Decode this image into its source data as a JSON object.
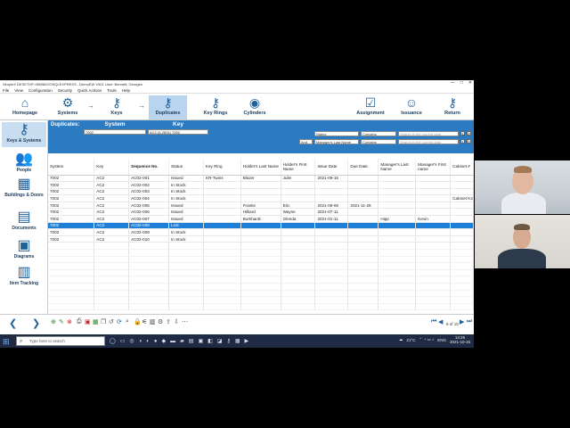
{
  "window": {
    "title": "SimpleX  DESKTOP-9KB56OO\\SQLEXPRESS - DemoEW V501     User: Bennett, Georges",
    "controls": [
      "—",
      "□",
      "✕"
    ]
  },
  "menu": [
    "File",
    "View",
    "Configuration",
    "Security",
    "Quick Actions",
    "Tools",
    "Help"
  ],
  "toolbar": {
    "items": [
      {
        "label": "Homepage",
        "icon": "building-icon"
      },
      {
        "label": "Systems",
        "icon": "systems-icon"
      },
      {
        "label": "Keys",
        "icon": "key-icon"
      },
      {
        "label": "Duplicates",
        "icon": "duplicate-keys-icon",
        "active": true
      },
      {
        "label": "Key Rings",
        "icon": "keyring-icon"
      },
      {
        "label": "Cylinders",
        "icon": "cylinder-icon"
      },
      {
        "label": "Assignment",
        "icon": "assignment-icon"
      },
      {
        "label": "Issuance",
        "icon": "issuance-icon"
      },
      {
        "label": "Return",
        "icon": "return-icon"
      }
    ]
  },
  "sidebar": [
    {
      "label": "Keys & Systems",
      "icon": "key-icon",
      "active": true
    },
    {
      "label": "People",
      "icon": "people-icon"
    },
    {
      "label": "Buildings & Doors",
      "icon": "building-icon"
    },
    {
      "label": "Documents",
      "icon": "documents-icon"
    },
    {
      "label": "Diagrams",
      "icon": "diagram-icon"
    },
    {
      "label": "Item Tracking",
      "icon": "item-tracking-icon"
    }
  ],
  "duplicates": {
    "title": "Duplicates:",
    "system_header": "System",
    "key_header": "Key",
    "system_value": "7002",
    "key_value": "AC2 (4-2831) 7002"
  },
  "filters": {
    "row1": {
      "field": "Status",
      "op": "Contains",
      "placeholder": "Search in the current data"
    },
    "row2": {
      "conj": "And",
      "field": "Manager's Last Name",
      "op": "Contains",
      "placeholder": "Search in the current data"
    }
  },
  "table": {
    "columns": [
      "System",
      "Key",
      "Sequence No.",
      "Status",
      "Key Ring",
      "Holder's Last Name",
      "Holder's First Name",
      "Issue Date",
      "Due Date",
      "Manager's Last Name",
      "Manager's First name",
      "Cabinet #"
    ],
    "rows": [
      [
        "7002",
        "AC2",
        "AC02-001",
        "Issued",
        "KR-Twins",
        "Blazer",
        "Julie",
        "2021-09-15",
        "",
        "",
        "",
        ""
      ],
      [
        "7002",
        "AC2",
        "AC02-002",
        "In Stock",
        "",
        "",
        "",
        "",
        "",
        "",
        "",
        ""
      ],
      [
        "7002",
        "AC2",
        "AC02-003",
        "In Stock",
        "",
        "",
        "",
        "",
        "",
        "",
        "",
        ""
      ],
      [
        "7002",
        "AC2",
        "AC02-004",
        "In Stock",
        "",
        "",
        "",
        "",
        "",
        "",
        "",
        "Cabinet K2"
      ],
      [
        "7002",
        "AC2",
        "AC02-005",
        "Issued",
        "",
        "Franke",
        "Eric",
        "2021-09-06",
        "2021-11-26",
        "",
        "",
        ""
      ],
      [
        "7002",
        "AC2",
        "AC02-006",
        "Issued",
        "",
        "Hilliard",
        "Wayne",
        "2021-07-11",
        "",
        "",
        "",
        ""
      ],
      [
        "7002",
        "AC2",
        "AC02-007",
        "Issued",
        "",
        "Burkhardt",
        "Glenda",
        "2021-01-11",
        "",
        "Hipp",
        "Kevin",
        ""
      ],
      [
        "7002",
        "AC2",
        "AC02-008",
        "Lost",
        "",
        "",
        "",
        "",
        "",
        "",
        "",
        ""
      ],
      [
        "7002",
        "AC2",
        "AC02-009",
        "In Stock",
        "",
        "",
        "",
        "",
        "",
        "",
        "",
        ""
      ],
      [
        "7002",
        "AC2",
        "AC02-010",
        "In Stock",
        "",
        "",
        "",
        "",
        "",
        "",
        "",
        ""
      ]
    ],
    "selected_row": 7
  },
  "pager": {
    "text": "8 of 10"
  },
  "taskbar": {
    "search_placeholder": "Type here to search",
    "weather": "21°C",
    "lang": "ENG",
    "time": "14:26",
    "date": "2021-10-15"
  }
}
